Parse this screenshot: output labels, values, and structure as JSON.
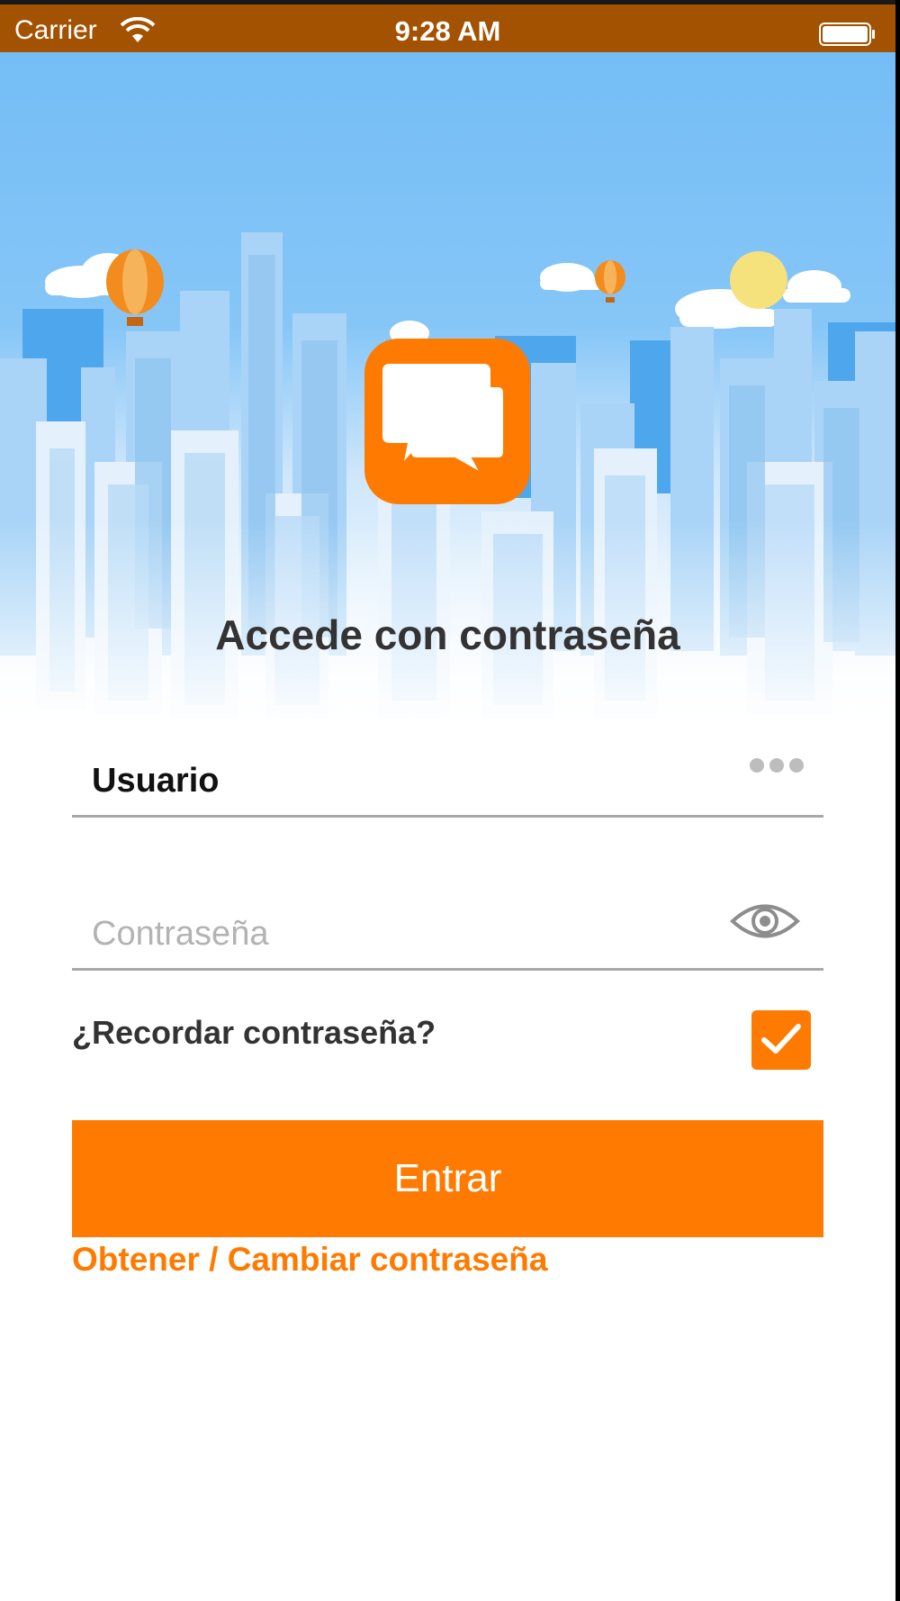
{
  "status_bar": {
    "carrier": "Carrier",
    "time": "9:28 AM",
    "wifi_icon": "wifi-icon",
    "battery_icon": "battery-full-icon"
  },
  "hero": {
    "sky_color": "#74bdf6",
    "logo_icon": "chat-bubbles-icon",
    "logo_color": "#ff7a00"
  },
  "login": {
    "title": "Accede con contraseña",
    "username_value": "Usuario",
    "username_menu_icon": "more-icon",
    "password_placeholder": "Contraseña",
    "password_toggle_icon": "eye-icon",
    "remember_label": "¿Recordar contraseña?",
    "remember_checked": true,
    "submit_label": "Entrar",
    "change_password_link": "Obtener / Cambiar contraseña"
  },
  "colors": {
    "accent": "#ff7a00",
    "status_bar": "#a25200",
    "title_text": "#333333"
  }
}
